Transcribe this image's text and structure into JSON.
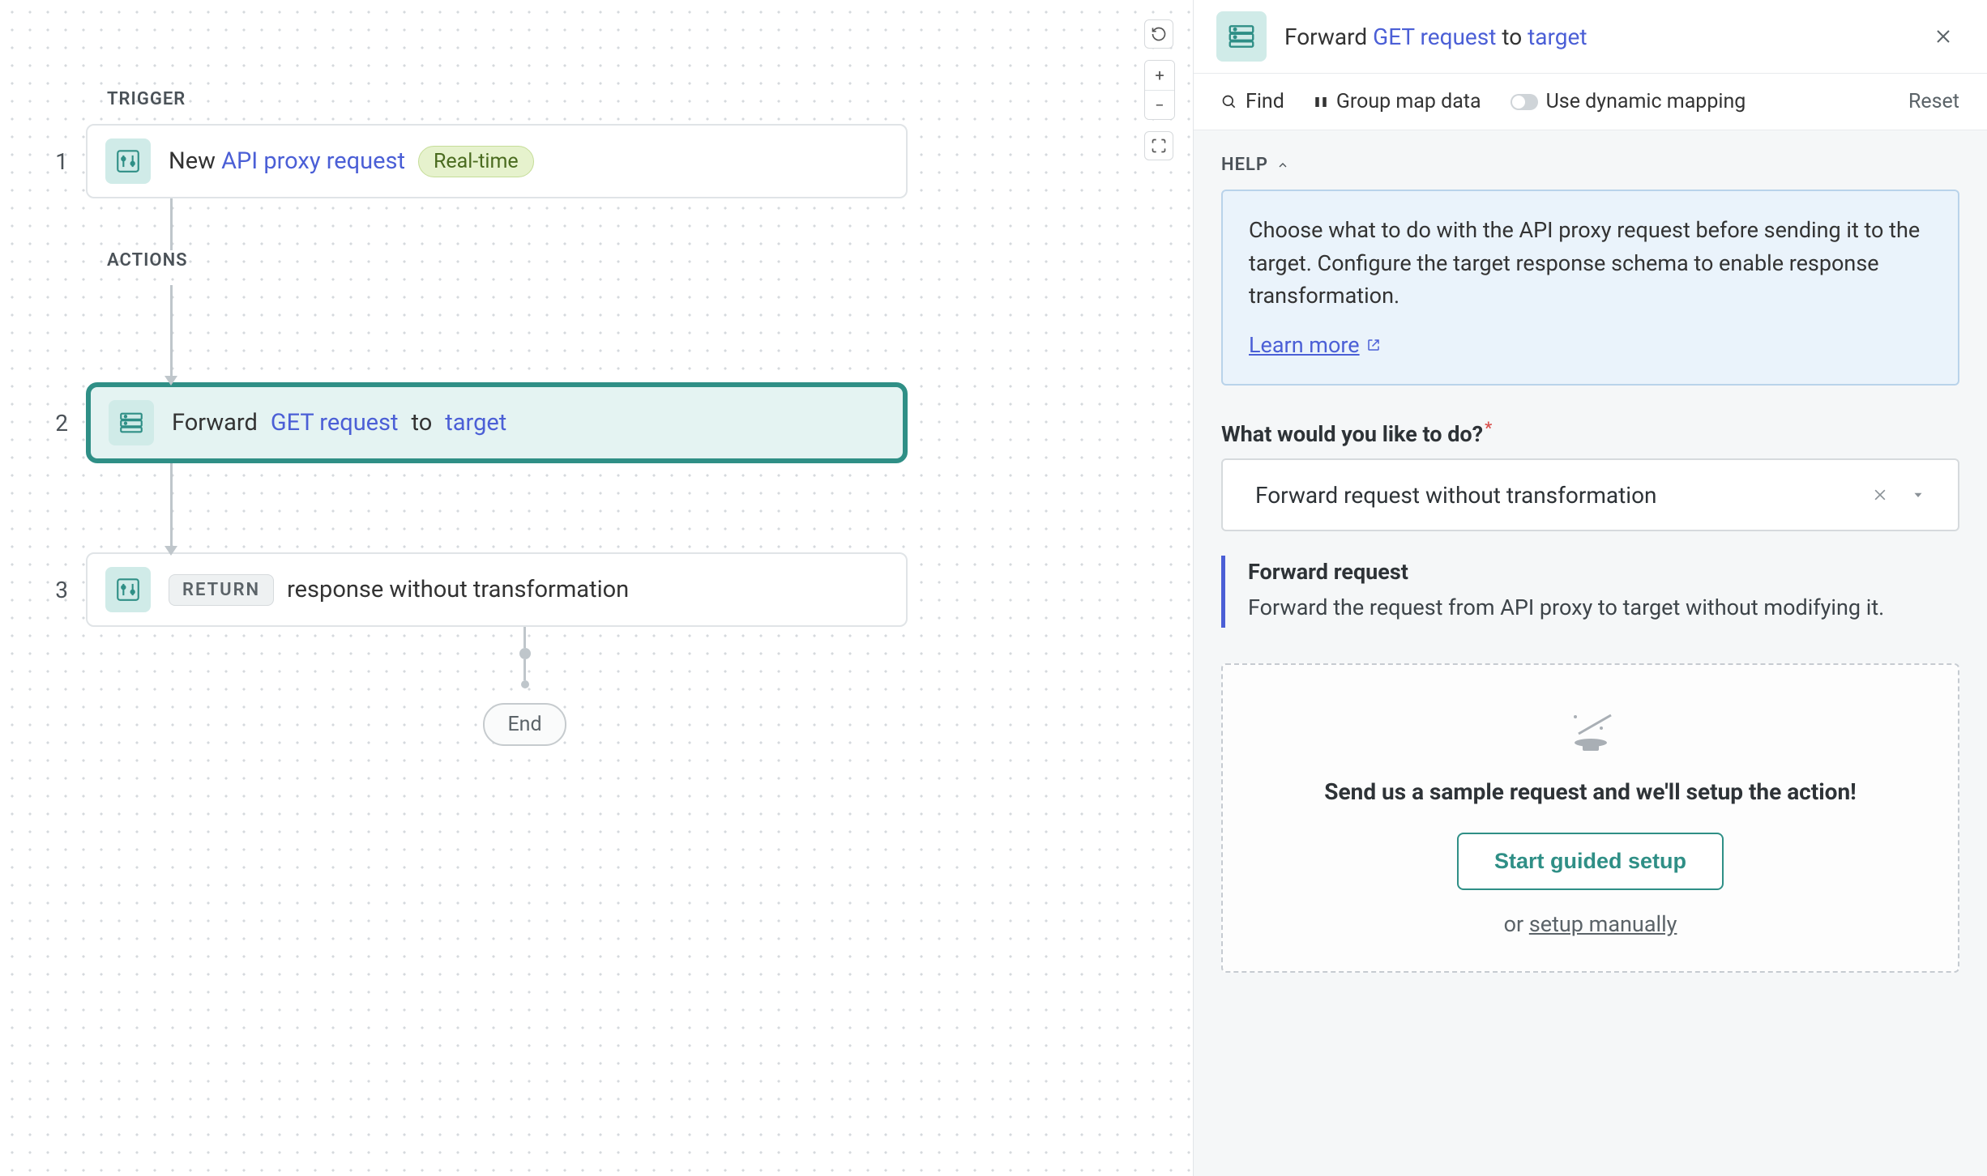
{
  "canvas": {
    "section_trigger": "TRIGGER",
    "section_actions": "ACTIONS",
    "end_label": "End",
    "rows": {
      "r1": {
        "num": "1",
        "pre": "New ",
        "link": "API proxy request",
        "badge": "Real-time"
      },
      "r2": {
        "num": "2",
        "pre": "Forward ",
        "link1": "GET request",
        "mid": " to ",
        "link2": "target"
      },
      "r3": {
        "num": "3",
        "badge": "RETURN",
        "text": "response without transformation"
      }
    }
  },
  "panel": {
    "title_pre": "Forward ",
    "title_link1": "GET request",
    "title_mid": " to ",
    "title_link2": "target",
    "toolbar": {
      "find": "Find",
      "group": "Group map data",
      "dynamic": "Use dynamic mapping",
      "reset": "Reset"
    },
    "help_label": "HELP",
    "help_text": "Choose what to do with the API proxy request before sending it to the target. Configure the target response schema to enable response transformation.",
    "learn_more": "Learn more",
    "field_label": "What would you like to do?",
    "select_value": "Forward request without transformation",
    "info": {
      "heading": "Forward request",
      "body": "Forward the request from API proxy to target without modifying it."
    },
    "guided": {
      "msg": "Send us a sample request and we'll setup the action!",
      "button": "Start guided setup",
      "or": "or ",
      "manual": "setup manually"
    }
  }
}
